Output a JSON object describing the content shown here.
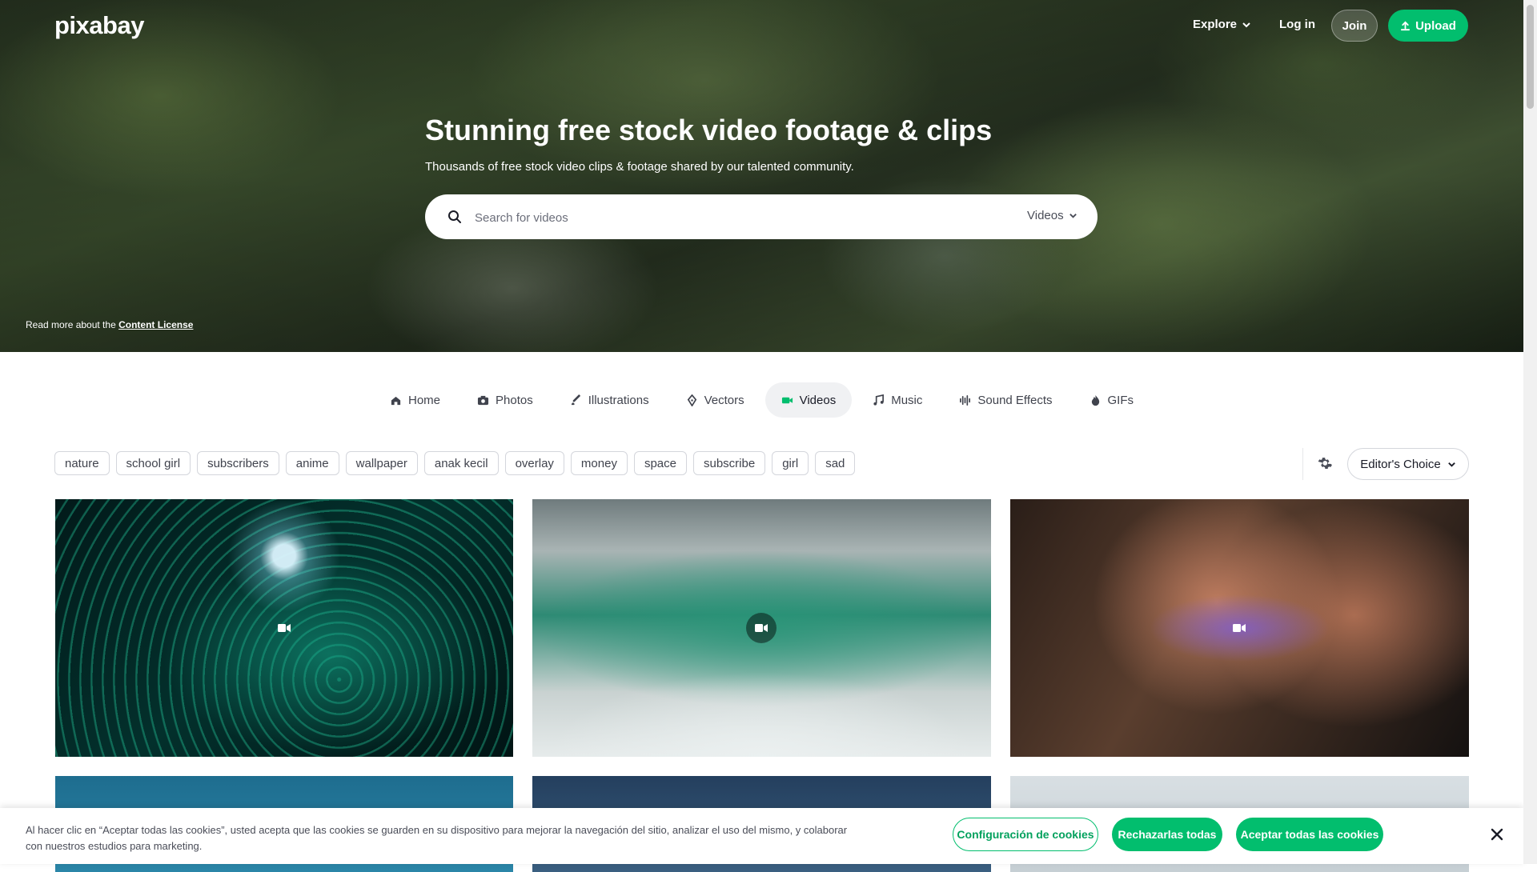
{
  "header": {
    "logo": "pixabay",
    "explore_label": "Explore",
    "login_label": "Log in",
    "join_label": "Join",
    "upload_label": "Upload"
  },
  "hero": {
    "title": "Stunning free stock video footage & clips",
    "subtitle": "Thousands of free stock video clips & footage shared by our talented community.",
    "search_placeholder": "Search for videos",
    "search_type": "Videos",
    "license_prefix": "Read more about the",
    "license_link": "Content License"
  },
  "categories": [
    {
      "label": "Home",
      "icon": "home-icon"
    },
    {
      "label": "Photos",
      "icon": "camera-icon"
    },
    {
      "label": "Illustrations",
      "icon": "brush-icon"
    },
    {
      "label": "Vectors",
      "icon": "pen-icon"
    },
    {
      "label": "Videos",
      "icon": "video-icon",
      "active": true
    },
    {
      "label": "Music",
      "icon": "music-icon"
    },
    {
      "label": "Sound Effects",
      "icon": "waveform-icon"
    },
    {
      "label": "GIFs",
      "icon": "gif-icon"
    }
  ],
  "tags": [
    "nature",
    "school girl",
    "subscribers",
    "anime",
    "wallpaper",
    "anak kecil",
    "overlay",
    "money",
    "space",
    "subscribe",
    "girl",
    "sad"
  ],
  "sort": {
    "label": "Editor's Choice"
  },
  "cookie_banner": {
    "text": "Al hacer clic en “Aceptar todas las cookies”, usted acepta que las cookies se guarden en su dispositivo para mejorar la navegación del sitio, analizar el uso del mismo, y colaborar con nuestros estudios para marketing.",
    "config_label": "Configuración de cookies",
    "reject_label": "Rechazarlas todas",
    "accept_label": "Aceptar todas las cookies"
  },
  "colors": {
    "accent": "#02be6e",
    "text": "#191b26"
  }
}
